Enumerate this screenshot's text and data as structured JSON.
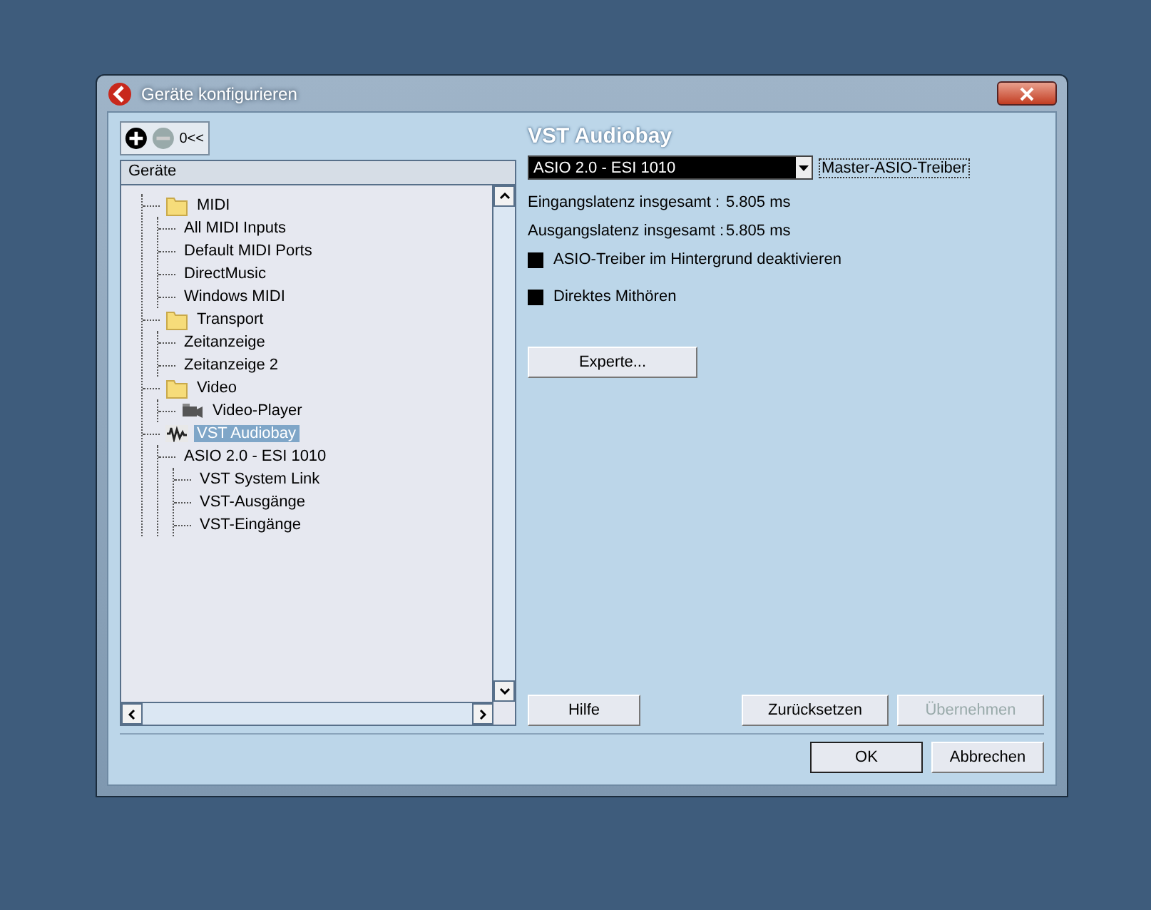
{
  "window": {
    "title": "Geräte konfigurieren"
  },
  "toolbar": {
    "collapse_label": "0<<"
  },
  "tree": {
    "header": "Geräte",
    "items": [
      {
        "label": "MIDI",
        "kind": "folder",
        "selected": false,
        "children": [
          {
            "label": "All MIDI Inputs",
            "selected": false
          },
          {
            "label": "Default MIDI Ports",
            "selected": false
          },
          {
            "label": "DirectMusic",
            "selected": false
          },
          {
            "label": "Windows MIDI",
            "selected": false
          }
        ]
      },
      {
        "label": "Transport",
        "kind": "folder",
        "selected": false,
        "children": [
          {
            "label": "Zeitanzeige",
            "selected": false
          },
          {
            "label": "Zeitanzeige 2",
            "selected": false
          }
        ]
      },
      {
        "label": "Video",
        "kind": "folder",
        "selected": false,
        "children": [
          {
            "label": "Video-Player",
            "kind": "video",
            "selected": false
          }
        ]
      },
      {
        "label": "VST Audiobay",
        "kind": "audio",
        "selected": true,
        "children": [
          {
            "label": "ASIO 2.0 - ESI 1010",
            "selected": false,
            "children": [
              {
                "label": "VST System Link",
                "selected": false
              },
              {
                "label": "VST-Ausgänge",
                "selected": false
              },
              {
                "label": "VST-Eingänge",
                "selected": false
              }
            ]
          }
        ]
      }
    ]
  },
  "panel": {
    "title": "VST Audiobay",
    "driver": {
      "value": "ASIO 2.0 - ESI 1010",
      "label": "Master-ASIO-Treiber"
    },
    "latencies": [
      {
        "label": "Eingangslatenz insgesamt :",
        "value": "5.805 ms"
      },
      {
        "label": "Ausgangslatenz insgesamt :",
        "value": "5.805 ms"
      }
    ],
    "options": [
      {
        "label": "ASIO-Treiber im Hintergrund deaktivieren",
        "checked": false
      },
      {
        "label": "Direktes Mithören",
        "checked": false
      }
    ],
    "expert_button": "Experte...",
    "buttons": [
      {
        "label": "Hilfe",
        "disabled": false
      },
      {
        "label": "Zurücksetzen",
        "disabled": false
      },
      {
        "label": "Übernehmen",
        "disabled": true
      }
    ]
  },
  "footer_buttons": [
    {
      "label": "OK",
      "default": true
    },
    {
      "label": "Abbrechen",
      "default": false
    }
  ]
}
